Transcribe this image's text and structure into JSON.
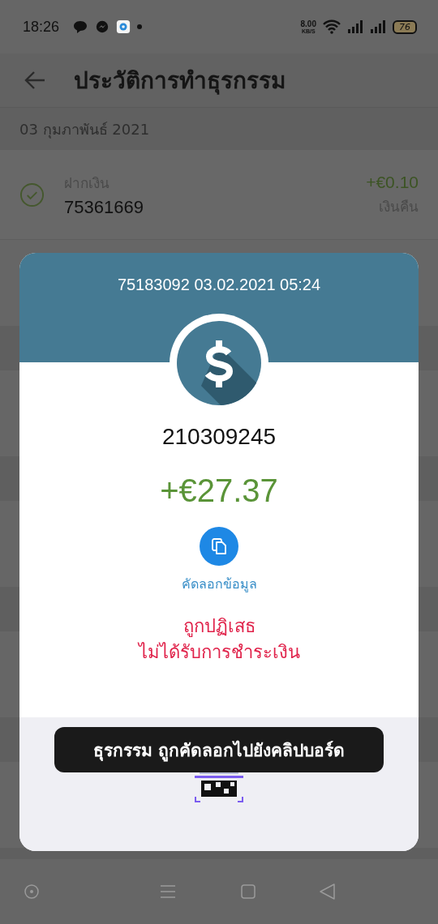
{
  "status_bar": {
    "time": "18:26",
    "net_speed": "8.00",
    "net_speed_unit": "KB/S",
    "battery": "76"
  },
  "header": {
    "title": "ประวัติการทำธุรกรรม"
  },
  "date_header": "03 กุมภาพันธ์ 2021",
  "transactions": [
    {
      "type_label": "ฝากเงิน",
      "number": "75361669",
      "amount": "+€0.10",
      "status": "เงินคืน",
      "completed": true
    }
  ],
  "dialog": {
    "title": "75183092 03.02.2021 05:24",
    "reference": "210309245",
    "amount": "+€27.37",
    "copy_label": "คัดลอกข้อมูล",
    "status_lines": [
      "ถูกปฏิเสธ",
      "ไม่ได้รับการชำระเงิน"
    ]
  },
  "toast": {
    "text": "ธุรกรรม ถูกคัดลอกไปยังคลิปบอร์ด"
  }
}
